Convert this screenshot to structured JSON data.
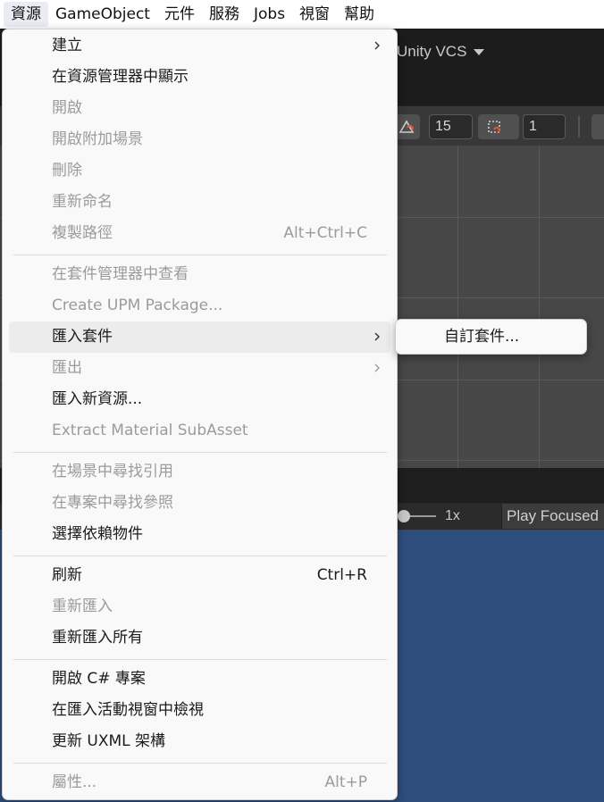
{
  "menubar": {
    "items": [
      "資源",
      "GameObject",
      "元件",
      "服務",
      "Jobs",
      "視窗",
      "幫助"
    ],
    "active_index": 0
  },
  "editor": {
    "vcs_label": "Unity VCS",
    "grid_size": "15",
    "snap_increment": "1",
    "zoom_label": "1x",
    "play_mode": "Play Focused"
  },
  "assets_menu": {
    "items": [
      {
        "label": "建立",
        "enabled": true,
        "submenu": true
      },
      {
        "label": "在資源管理器中顯示",
        "enabled": true
      },
      {
        "label": "開啟",
        "enabled": false
      },
      {
        "label": "開啟附加場景",
        "enabled": false
      },
      {
        "label": "刪除",
        "enabled": false
      },
      {
        "label": "重新命名",
        "enabled": false
      },
      {
        "label": "複製路徑",
        "enabled": false,
        "shortcut": "Alt+Ctrl+C"
      },
      {
        "label": "在套件管理器中查看",
        "enabled": false
      },
      {
        "label": "Create UPM Package...",
        "enabled": false
      },
      {
        "label": "匯入套件",
        "enabled": true,
        "submenu": true,
        "highlighted": true
      },
      {
        "label": "匯出",
        "enabled": false,
        "submenu": true
      },
      {
        "label": "匯入新資源...",
        "enabled": true
      },
      {
        "label": "Extract Material SubAsset",
        "enabled": false
      },
      {
        "label": "在場景中尋找引用",
        "enabled": false
      },
      {
        "label": "在專案中尋找參照",
        "enabled": false
      },
      {
        "label": "選擇依賴物件",
        "enabled": true
      },
      {
        "label": "刷新",
        "enabled": true,
        "shortcut": "Ctrl+R"
      },
      {
        "label": "重新匯入",
        "enabled": false
      },
      {
        "label": "重新匯入所有",
        "enabled": true
      },
      {
        "label": "開啟 C# 專案",
        "enabled": true
      },
      {
        "label": "在匯入活動視窗中檢視",
        "enabled": true
      },
      {
        "label": "更新 UXML 架構",
        "enabled": true
      },
      {
        "label": "屬性...",
        "enabled": false,
        "shortcut": "Alt+P"
      }
    ]
  },
  "import_package_submenu": {
    "items": [
      {
        "label": "自訂套件...",
        "enabled": true
      }
    ]
  },
  "colors": {
    "menu_background": "#f9f9f9",
    "menu_highlight": "#ececec",
    "disabled_text": "#9b9b9b",
    "scene_background": "#474747",
    "game_view_background": "#2e4e7d"
  }
}
